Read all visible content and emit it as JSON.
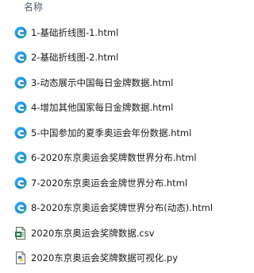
{
  "header": {
    "name_column": "名称"
  },
  "files": [
    {
      "name": "1-基础折线图-1.html",
      "icon": "edge-icon"
    },
    {
      "name": "2-基础折线图-2.html",
      "icon": "edge-icon"
    },
    {
      "name": "3-动态展示中国每日金牌数据.html",
      "icon": "edge-icon"
    },
    {
      "name": "4-增加其他国家每日金牌数据.html",
      "icon": "edge-icon"
    },
    {
      "name": "5-中国参加的夏季奥运会年份数据.html",
      "icon": "edge-icon"
    },
    {
      "name": "6-2020东京奥运会奖牌数世界分布.html",
      "icon": "edge-icon"
    },
    {
      "name": "7-2020东京奥运会金牌世界分布.html",
      "icon": "edge-icon"
    },
    {
      "name": "8-2020东京奥运会奖牌世界分布(动态).html",
      "icon": "edge-icon"
    },
    {
      "name": "2020东京奥运会奖牌数据.csv",
      "icon": "csv-file-icon"
    },
    {
      "name": "2020东京奥运会奖牌数据可视化.py",
      "icon": "python-file-icon"
    }
  ]
}
